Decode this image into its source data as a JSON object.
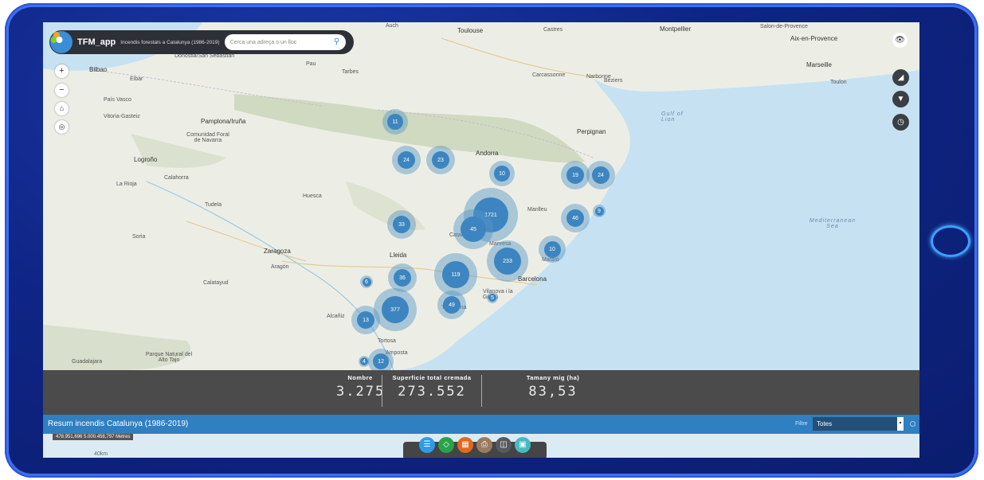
{
  "app": {
    "name": "TFM_app",
    "subtitle": "Incendis forestals a Catalunya (1986-2019)",
    "search_placeholder": "Cerca una adreça o un lloc"
  },
  "map_controls": [
    "zoom-in",
    "zoom-out",
    "home",
    "locate"
  ],
  "map_labels": [
    {
      "text": "Auch"
    },
    {
      "text": "Toulouse"
    },
    {
      "text": "Castres"
    },
    {
      "text": "Montpellier"
    },
    {
      "text": "Salon-de-Provence"
    },
    {
      "text": "Aix-en-Provence"
    },
    {
      "text": "Marseille"
    },
    {
      "text": "Toulon"
    },
    {
      "text": "Béziers"
    },
    {
      "text": "Narbonne"
    },
    {
      "text": "Carcassonne"
    },
    {
      "text": "Tarbes"
    },
    {
      "text": "Pau"
    },
    {
      "text": "Donostia/San Sebastián"
    },
    {
      "text": "Bilbao"
    },
    {
      "text": "Eibar"
    },
    {
      "text": "País Vasco"
    },
    {
      "text": "Vitoria-Gasteiz"
    },
    {
      "text": "Pamplona/Iruña"
    },
    {
      "text": "Comunidad Foral de Navarra"
    },
    {
      "text": "Logroño"
    },
    {
      "text": "La Rioja"
    },
    {
      "text": "Calahorra"
    },
    {
      "text": "Tudela"
    },
    {
      "text": "Huesca"
    },
    {
      "text": "Zaragoza"
    },
    {
      "text": "Aragón"
    },
    {
      "text": "Soria"
    },
    {
      "text": "Calatayud"
    },
    {
      "text": "Alcañiz"
    },
    {
      "text": "Lleida"
    },
    {
      "text": "Andorra"
    },
    {
      "text": "Perpignan"
    },
    {
      "text": "Manlleu"
    },
    {
      "text": "Manresa"
    },
    {
      "text": "Mataró"
    },
    {
      "text": "Barcelona"
    },
    {
      "text": "Vilanova i la Geltrú"
    },
    {
      "text": "Tarragona"
    },
    {
      "text": "Tortosa"
    },
    {
      "text": "Amposta"
    },
    {
      "text": "Guadalajara"
    },
    {
      "text": "Parque Natural del Alto Tajo"
    },
    {
      "text": "Gulf of Lion"
    },
    {
      "text": "Mediterranean Sea"
    },
    {
      "text": "Catalonia"
    }
  ],
  "clusters": [
    {
      "count": "11"
    },
    {
      "count": "24"
    },
    {
      "count": "23"
    },
    {
      "count": "10"
    },
    {
      "count": "19"
    },
    {
      "count": "24"
    },
    {
      "count": "1721"
    },
    {
      "count": "45"
    },
    {
      "count": "46"
    },
    {
      "count": "9"
    },
    {
      "count": "33"
    },
    {
      "count": "10"
    },
    {
      "count": "233"
    },
    {
      "count": "119"
    },
    {
      "count": "36"
    },
    {
      "count": "6"
    },
    {
      "count": "49"
    },
    {
      "count": "5"
    },
    {
      "count": "377"
    },
    {
      "count": "13"
    },
    {
      "count": "4"
    },
    {
      "count": "12"
    }
  ],
  "stats": {
    "nombre_label": "Nombre",
    "nombre_value": "3.275",
    "superficie_label": "Superficie total cremada",
    "superficie_value": "273.552",
    "tamany_label": "Tamany mig (ha)",
    "tamany_value": "83,53"
  },
  "resum": {
    "title": "Resum incendis Catalunya (1986-2019)",
    "filter_label": "Filtre",
    "filter_value": "Totes"
  },
  "bottom": {
    "coords": "478.951,696 5.000.458,797 Metres",
    "scale": "40km"
  },
  "dock_buttons": [
    "list-icon",
    "layers-icon",
    "basemap-icon",
    "print-icon",
    "grid-icon",
    "widget-icon"
  ],
  "colors": {
    "cluster": "#3d85c0",
    "resum_bar": "#2f7fc1",
    "stats_bg": "#4b4b4b"
  }
}
